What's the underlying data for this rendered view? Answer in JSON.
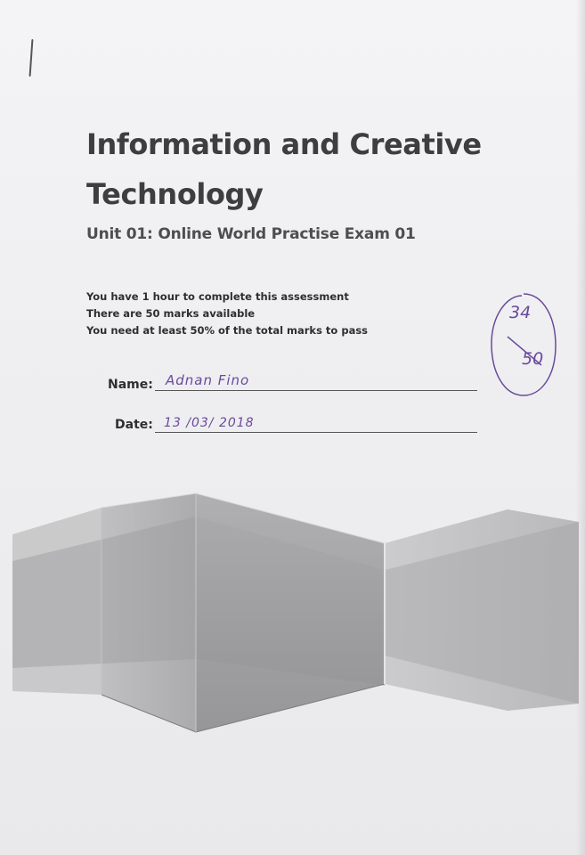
{
  "document": {
    "title_line1": "Information and Creative",
    "title_line2": "Technology",
    "subtitle": "Unit 01: Online World Practise Exam 01",
    "instructions": [
      "You have 1 hour to complete this assessment",
      "There are 50 marks available",
      "You need at least 50% of the total marks to pass"
    ],
    "name_label": "Name:",
    "name_value": "Adnan Fino",
    "date_label": "Date:",
    "date_value": "13 /03/ 2018",
    "score_obtained": "34",
    "score_total": "50"
  },
  "colors": {
    "paper": "#f1f1f3",
    "title_text": "#3e3e40",
    "ink_purple": "#6a4a9a",
    "graphic_gray": "#9a9a9c"
  }
}
